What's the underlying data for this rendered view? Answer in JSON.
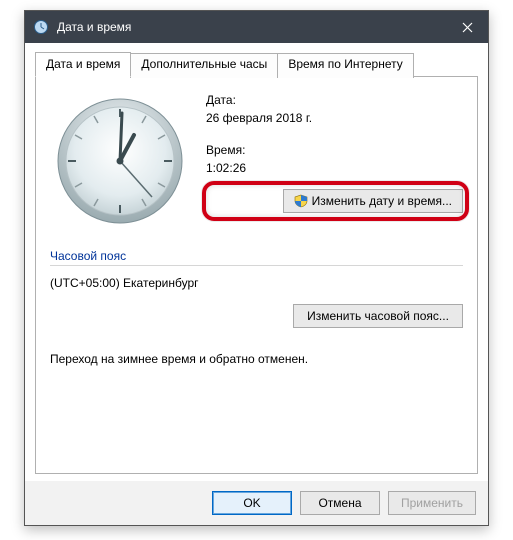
{
  "title": "Дата и время",
  "tabs": {
    "t0": "Дата и время",
    "t1": "Дополнительные часы",
    "t2": "Время по Интернету"
  },
  "date_label": "Дата:",
  "date_value": "26 февраля 2018 г.",
  "time_label": "Время:",
  "time_value": "1:02:26",
  "change_datetime_btn": "Изменить дату и время...",
  "tz_section": "Часовой пояс",
  "tz_value": "(UTC+05:00) Екатеринбург",
  "change_tz_btn": "Изменить часовой пояс...",
  "dst_text": "Переход на зимнее время и обратно отменен.",
  "ok": "OK",
  "cancel": "Отмена",
  "apply": "Применить"
}
